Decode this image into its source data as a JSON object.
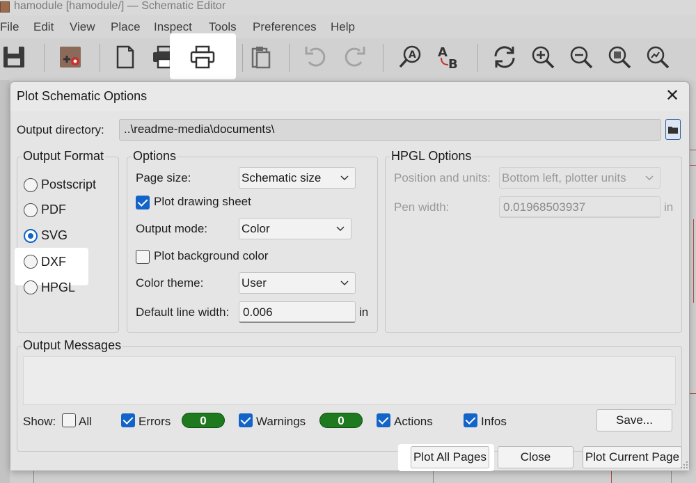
{
  "window": {
    "title": "hamodule [hamodule/] — Schematic Editor",
    "menu": [
      "File",
      "Edit",
      "View",
      "Place",
      "Inspect",
      "Tools",
      "Preferences",
      "Help"
    ]
  },
  "toolbar": {
    "buttons": [
      "save-icon",
      "schematic-setup-icon",
      "page-settings-icon",
      "print-icon",
      "plot-icon",
      "paste-icon",
      "undo-icon",
      "redo-icon",
      "find-icon",
      "find-replace-icon",
      "refresh-icon",
      "zoom-in-icon",
      "zoom-out-icon",
      "zoom-fit-icon",
      "zoom-objects-icon"
    ]
  },
  "dialog": {
    "title": "Plot Schematic Options",
    "output_directory_label": "Output directory:",
    "output_directory_value": "..\\readme-media\\documents\\",
    "output_format": {
      "title": "Output Format",
      "options": [
        "Postscript",
        "PDF",
        "SVG",
        "DXF",
        "HPGL"
      ],
      "selected": "SVG"
    },
    "options": {
      "title": "Options",
      "page_size_label": "Page size:",
      "page_size_value": "Schematic size",
      "plot_drawing_sheet_label": "Plot drawing sheet",
      "plot_drawing_sheet_checked": true,
      "output_mode_label": "Output mode:",
      "output_mode_value": "Color",
      "plot_background_label": "Plot background color",
      "plot_background_checked": false,
      "color_theme_label": "Color theme:",
      "color_theme_value": "User",
      "default_line_width_label": "Default line width:",
      "default_line_width_value": "0.006",
      "default_line_width_unit": "in"
    },
    "hpgl": {
      "title": "HPGL Options",
      "position_label": "Position and units:",
      "position_value": "Bottom left, plotter units",
      "pen_width_label": "Pen width:",
      "pen_width_value": "0.01968503937",
      "pen_width_unit": "in"
    },
    "messages": {
      "title": "Output Messages",
      "show_label": "Show:",
      "all_label": "All",
      "errors_label": "Errors",
      "errors_count": "0",
      "warnings_label": "Warnings",
      "warnings_count": "0",
      "actions_label": "Actions",
      "infos_label": "Infos",
      "save_button": "Save..."
    },
    "buttons": {
      "plot_all": "Plot All Pages",
      "close": "Close",
      "plot_current": "Plot Current Page"
    }
  },
  "colors": {
    "accent": "#1264c8",
    "badge_green": "#1f7a1f"
  }
}
